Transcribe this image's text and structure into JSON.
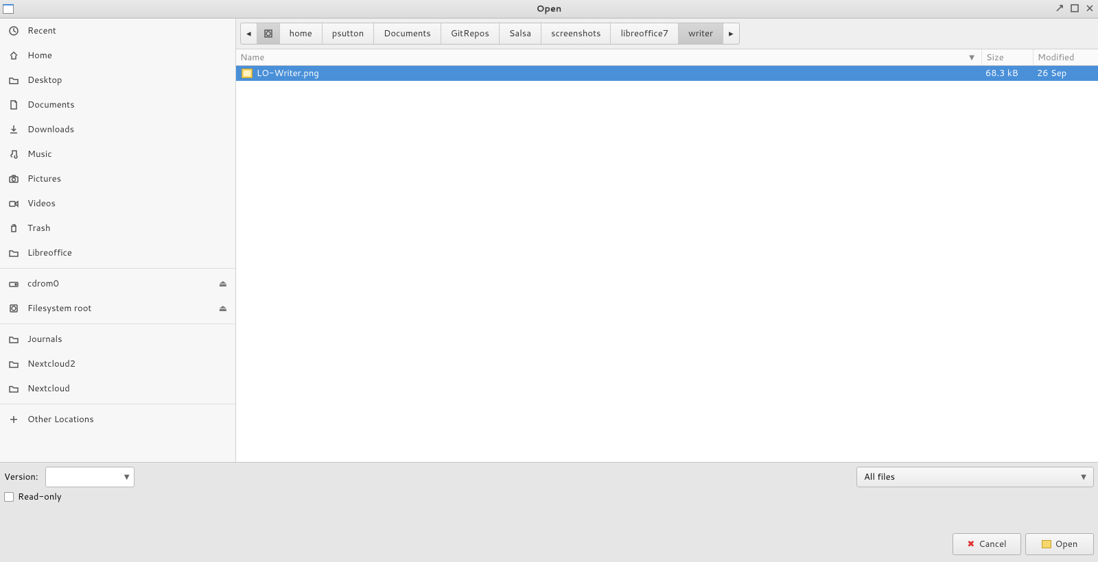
{
  "window": {
    "title": "Open"
  },
  "sidebar": {
    "group1": [
      {
        "label": "Recent",
        "icon": "clock-icon",
        "eject": false
      },
      {
        "label": "Home",
        "icon": "home-icon",
        "eject": false
      },
      {
        "label": "Desktop",
        "icon": "folder-icon",
        "eject": false
      },
      {
        "label": "Documents",
        "icon": "document-icon",
        "eject": false
      },
      {
        "label": "Downloads",
        "icon": "download-icon",
        "eject": false
      },
      {
        "label": "Music",
        "icon": "music-icon",
        "eject": false
      },
      {
        "label": "Pictures",
        "icon": "camera-icon",
        "eject": false
      },
      {
        "label": "Videos",
        "icon": "video-icon",
        "eject": false
      },
      {
        "label": "Trash",
        "icon": "trash-icon",
        "eject": false
      },
      {
        "label": "Libreoffice",
        "icon": "folder-icon",
        "eject": false
      }
    ],
    "group2": [
      {
        "label": "cdrom0",
        "icon": "drive-icon",
        "eject": true
      },
      {
        "label": "Filesystem root",
        "icon": "harddisk-icon",
        "eject": true
      }
    ],
    "group3": [
      {
        "label": "Journals",
        "icon": "folder-icon",
        "eject": false
      },
      {
        "label": "Nextcloud2",
        "icon": "folder-icon",
        "eject": false
      },
      {
        "label": "Nextcloud",
        "icon": "folder-icon",
        "eject": false
      }
    ],
    "group4": [
      {
        "label": "Other Locations",
        "icon": "plus-icon",
        "eject": false
      }
    ]
  },
  "pathbar": [
    "home",
    "psutton",
    "Documents",
    "GitRepos",
    "Salsa",
    "screenshots",
    "libreoffice7",
    "writer"
  ],
  "pathbar_active_index": 7,
  "columns": {
    "name": "Name",
    "size": "Size",
    "modified": "Modified"
  },
  "files": [
    {
      "name": "LO-Writer.png",
      "size": "68.3 kB",
      "modified": "26 Sep",
      "selected": true
    }
  ],
  "footer": {
    "version_label": "Version:",
    "version_value": "",
    "readonly_label": "Read-only",
    "readonly_checked": false,
    "filter_value": "All files",
    "cancel_label": "Cancel",
    "open_label": "Open"
  }
}
